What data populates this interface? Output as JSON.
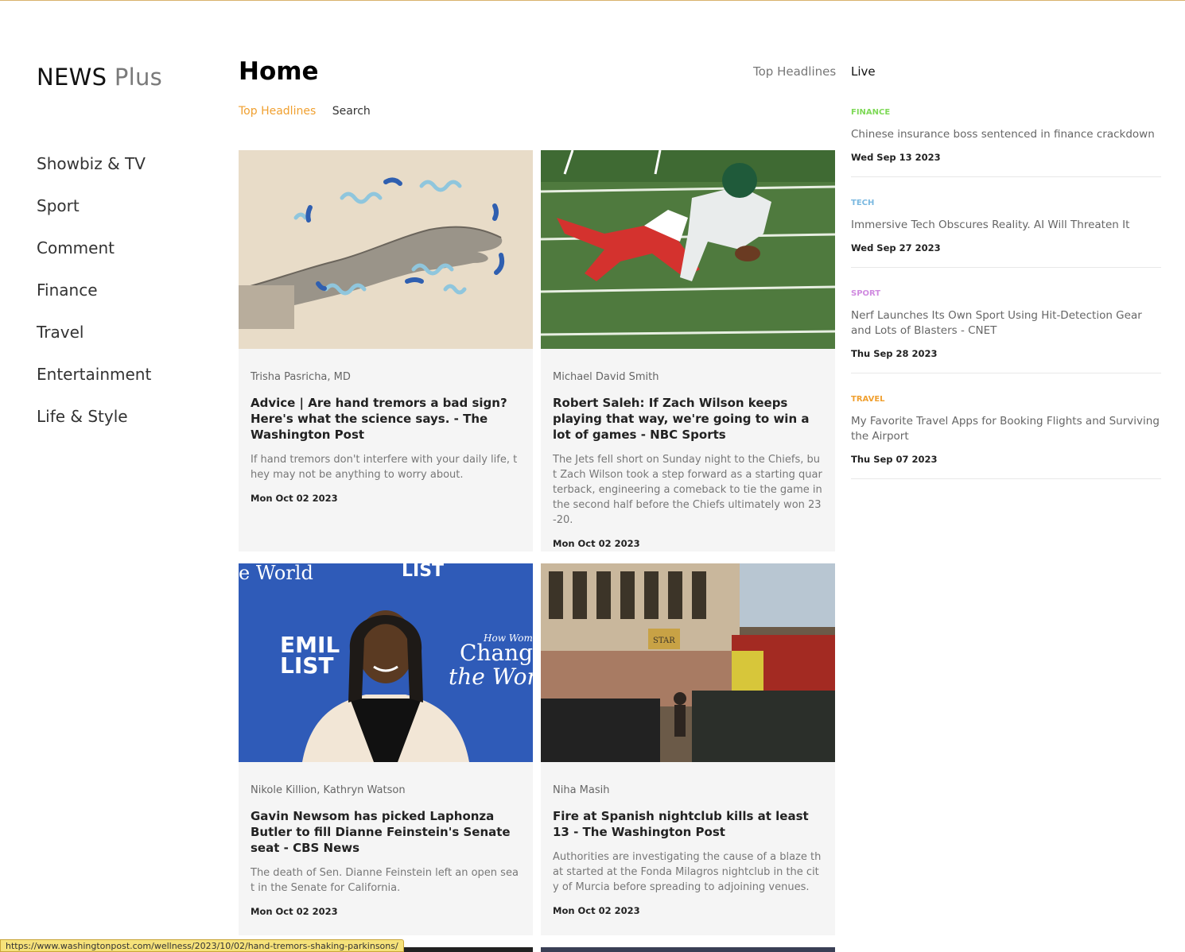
{
  "brand": {
    "name": "NEWS",
    "suffix": "Plus"
  },
  "sidebar": {
    "items": [
      {
        "label": "Showbiz & TV"
      },
      {
        "label": "Sport"
      },
      {
        "label": "Comment"
      },
      {
        "label": "Finance"
      },
      {
        "label": "Travel"
      },
      {
        "label": "Entertainment"
      },
      {
        "label": "Life & Style"
      }
    ]
  },
  "header": {
    "title": "Home",
    "links": {
      "top_headlines": "Top Headlines",
      "live": "Live"
    }
  },
  "subtabs": {
    "active": "Top Headlines",
    "search": "Search"
  },
  "articles": [
    {
      "author": "Trisha Pasricha, MD",
      "title": "Advice | Are hand tremors a bad sign? Here's what the science says. - The Washington Post",
      "desc": "If hand tremors don't interfere with your daily life, they may not be anything to worry about.",
      "date": "Mon Oct 02 2023"
    },
    {
      "author": "Michael David Smith",
      "title": "Robert Saleh: If Zach Wilson keeps playing that way, we're going to win a lot of games - NBC Sports",
      "desc": "The Jets fell short on Sunday night to the Chiefs, but Zach Wilson took a step forward as a starting quarterback, engineering a comeback to tie the game in the second half before the Chiefs ultimately won 23-20.",
      "date": "Mon Oct 02 2023"
    },
    {
      "author": "Nikole Killion, Kathryn Watson",
      "title": "Gavin Newsom has picked Laphonza Butler to fill Dianne Feinstein's Senate seat - CBS News",
      "desc": "The death of Sen. Dianne Feinstein left an open seat in the Senate for California.",
      "date": "Mon Oct 02 2023"
    },
    {
      "author": "Niha Masih",
      "title": "Fire at Spanish nightclub kills at least 13 - The Washington Post",
      "desc": "Authorities are investigating the cause of a blaze that started at the Fonda Milagros nightclub in the city of Murcia before spreading to adjoining venues.",
      "date": "Mon Oct 02 2023"
    }
  ],
  "live": [
    {
      "category": "FINANCE",
      "color": "#7ed957",
      "title": "Chinese insurance boss sentenced in finance crackdown",
      "date": "Wed Sep 13 2023"
    },
    {
      "category": "TECH",
      "color": "#7ab8e0",
      "title": "Immersive Tech Obscures Reality. AI Will Threaten It",
      "date": "Wed Sep 27 2023"
    },
    {
      "category": "SPORT",
      "color": "#d08be0",
      "title": "Nerf Launches Its Own Sport Using Hit-Detection Gear and Lots of Blasters - CNET",
      "date": "Thu Sep 28 2023"
    },
    {
      "category": "TRAVEL",
      "color": "#f0a030",
      "title": "My Favorite Travel Apps for Booking Flights and Surviving the Airport",
      "date": "Thu Sep 07 2023"
    }
  ],
  "image_text": {
    "ad1": "e World",
    "ad2": "LIST",
    "ad3": "EMIL",
    "ad4": "LIST",
    "ad5": "How Women",
    "ad6": "Change",
    "ad7": "the World",
    "sign": "STAR"
  },
  "status_url": "https://www.washingtonpost.com/wellness/2023/10/02/hand-tremors-shaking-parkinsons/"
}
